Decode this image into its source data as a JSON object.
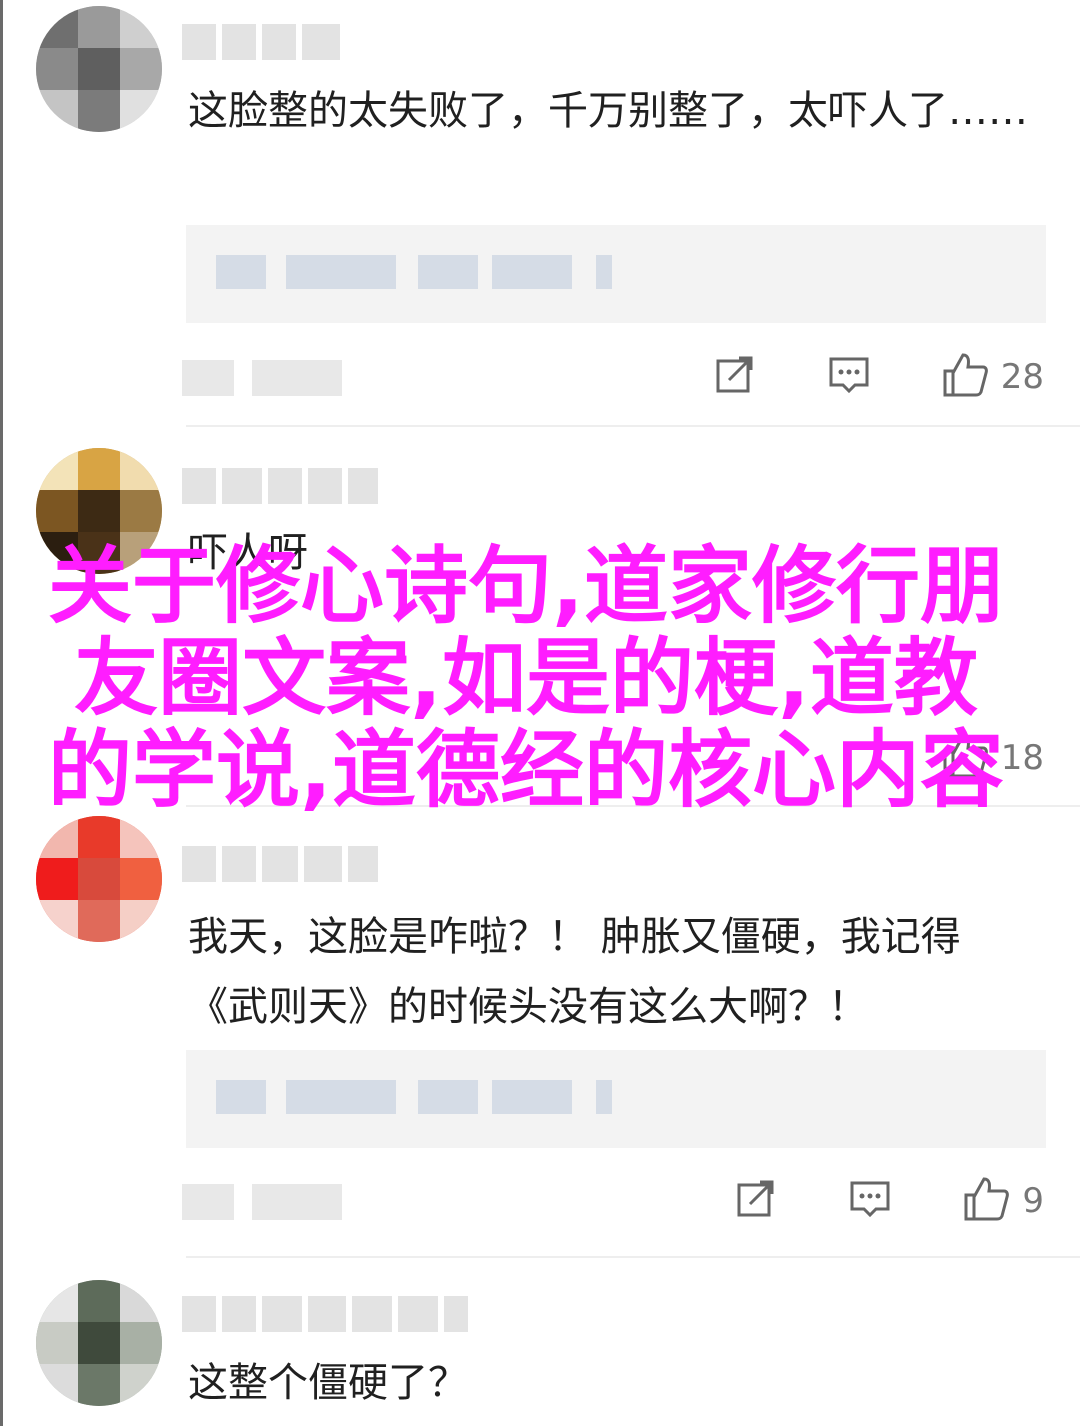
{
  "comments": [
    {
      "text": "这脸整的太失败了，千万别整了，太吓人了……",
      "likes": "28",
      "has_quote": true
    },
    {
      "text": "吓人呀",
      "likes": "18",
      "has_quote": false
    },
    {
      "text": "我天，这脸是咋啦？！ 肿胀又僵硬，我记得《武则天》的时候头没有这么大啊？！",
      "likes": "9",
      "has_quote": true
    },
    {
      "text": "这整个僵硬了？",
      "likes": "",
      "has_quote": false
    }
  ],
  "overlay_title": "关于修心诗句,道家修行朋友圈文案,如是的梗,道教的学说,道德经的核心内容",
  "icons": {
    "share": "share-icon",
    "reply": "reply-icon",
    "like": "thumbs-up-icon"
  },
  "colors": {
    "overlay_text": "#ff1dff",
    "blurred_name": "#e3e3e3",
    "quote_bg": "#f3f3f3"
  }
}
